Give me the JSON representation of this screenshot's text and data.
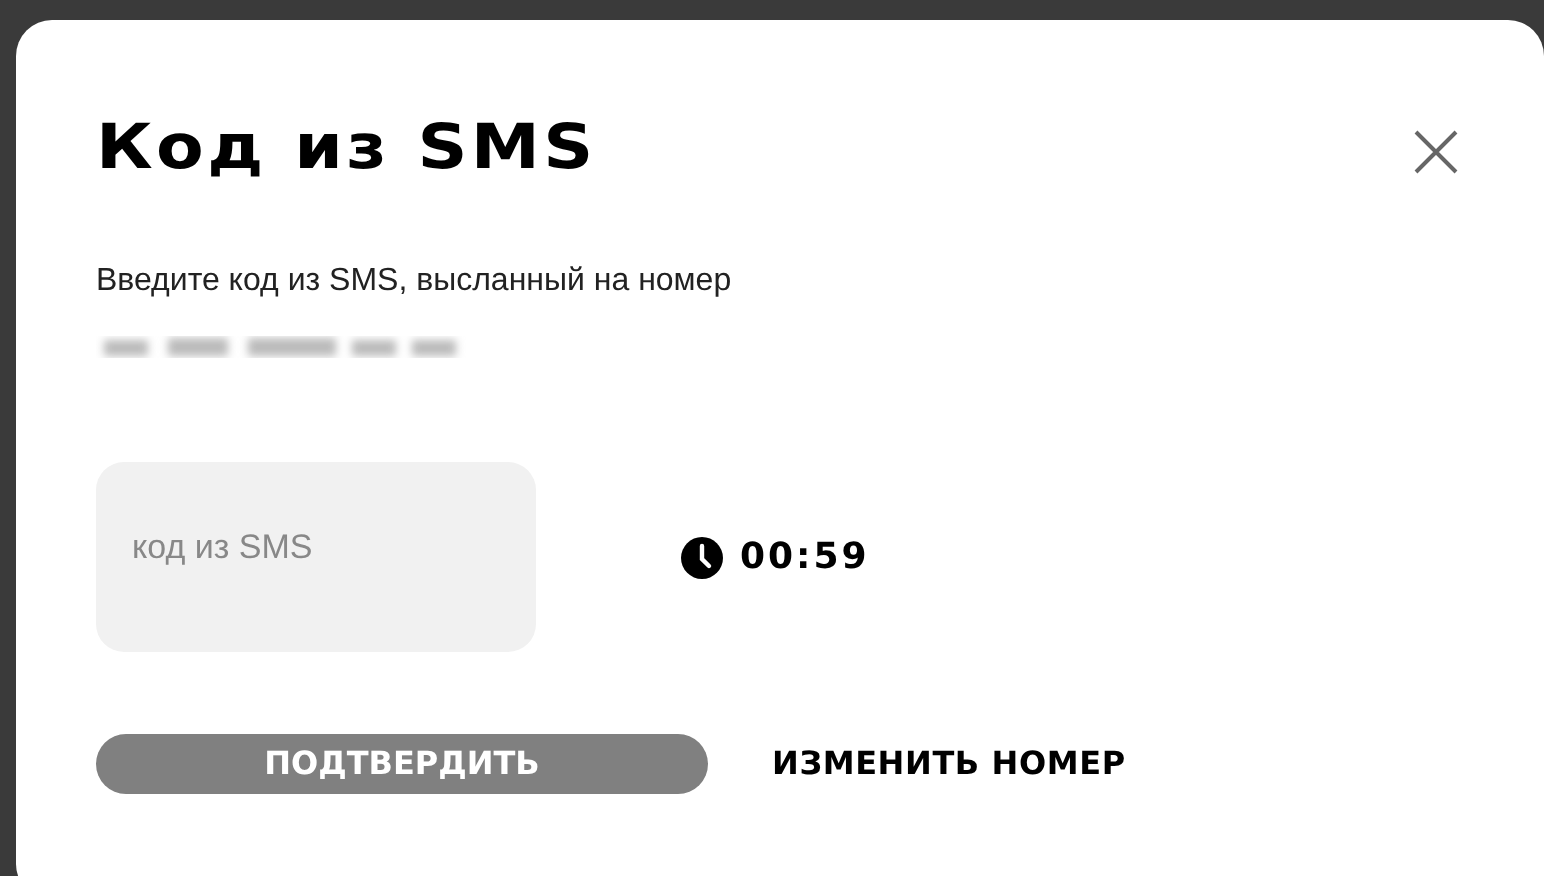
{
  "dialog": {
    "title": "Код из SMS",
    "message": "Введите код из SMS, высланный на номер",
    "code_field": {
      "placeholder": "код из SMS"
    },
    "timer": "00:59",
    "confirm_button": {
      "label": "ПОДТВЕРДИТЬ",
      "disabled": true
    },
    "change_number_link": "ИЗМЕНИТЬ НОМЕР"
  }
}
